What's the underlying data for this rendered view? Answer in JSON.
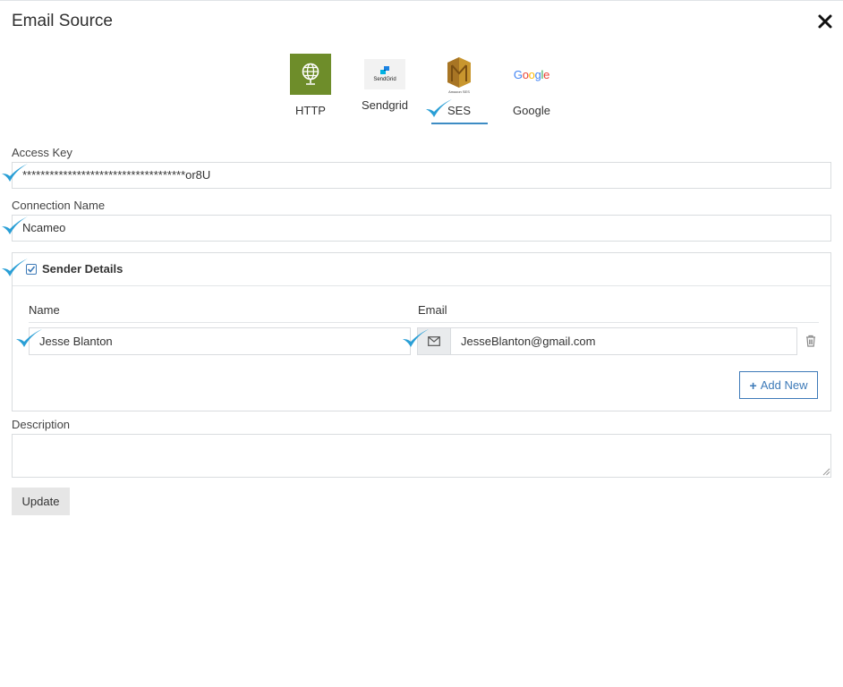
{
  "dialog": {
    "title": "Email Source",
    "close_icon": "close-icon"
  },
  "providers": [
    {
      "label": "HTTP",
      "icon": "globe-icon",
      "color": "#6e8d2a"
    },
    {
      "label": "Sendgrid",
      "icon": "sendgrid-logo",
      "logo_text": "SendGrid"
    },
    {
      "label": "SES",
      "icon": "amazon-ses-logo",
      "logo_text": "Amazon SES",
      "selected": true
    },
    {
      "label": "Google",
      "icon": "google-logo",
      "logo_text": "Google"
    }
  ],
  "access_key": {
    "label": "Access Key",
    "value": "************************************or8U"
  },
  "connection_name": {
    "label": "Connection Name",
    "value": "Ncameo"
  },
  "sender_details": {
    "title": "Sender Details",
    "checked": true,
    "columns": {
      "name": "Name",
      "email": "Email"
    },
    "rows": [
      {
        "name": "Jesse Blanton",
        "email": "JesseBlanton@gmail.com"
      }
    ],
    "add_label": "Add New"
  },
  "description": {
    "label": "Description",
    "value": ""
  },
  "actions": {
    "update_label": "Update"
  },
  "colors": {
    "accent": "#3d8cc4",
    "tick": "#2a9fd6",
    "http_bg": "#6e8d2a",
    "ses_gold": "#c8962e"
  }
}
